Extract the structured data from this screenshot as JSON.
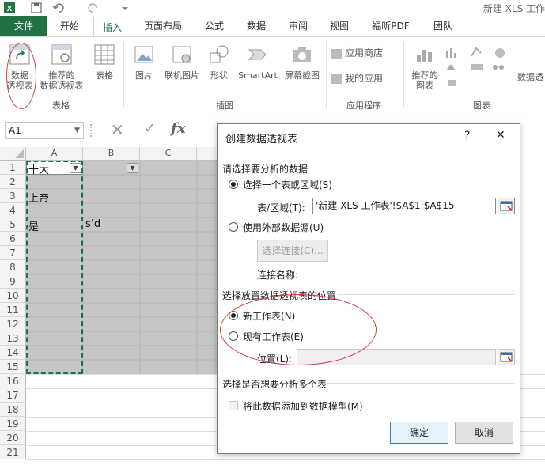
{
  "window": {
    "title": "新建 XLS 工作"
  },
  "tabs": {
    "file": "文件",
    "home": "开始",
    "insert": "插入",
    "layout": "页面布局",
    "formulas": "公式",
    "data": "数据",
    "review": "审阅",
    "view": "视图",
    "foxit": "福昕PDF",
    "team": "团队"
  },
  "ribbon": {
    "pivot": {
      "line1": "数据",
      "line2": "透视表"
    },
    "rec_pivot": {
      "line1": "推荐的",
      "line2": "数据透视表"
    },
    "table": "表格",
    "picture": "图片",
    "online_picture": "联机图片",
    "shapes": "形状",
    "smartart": "SmartArt",
    "screenshot": "屏幕截图",
    "app_store": "应用商店",
    "my_apps": "我的应用",
    "rec_chart": {
      "line1": "推荐的",
      "line2": "图表"
    },
    "pivot_chart_partial": "数据透",
    "groups": {
      "tables": "表格",
      "illustrations": "插图",
      "apps": "应用程序",
      "charts": "图表"
    }
  },
  "formula_bar": {
    "name_box": "A1",
    "fx": "fx"
  },
  "sheet": {
    "columns": [
      "A",
      "B",
      "C"
    ],
    "rows": [
      "1",
      "2",
      "3",
      "4",
      "5",
      "6",
      "7",
      "8",
      "9",
      "10",
      "11",
      "12",
      "13",
      "14",
      "15",
      "16",
      "17",
      "18",
      "19",
      "20",
      "21"
    ],
    "a1": "十大",
    "a3": "上帝",
    "a5": "是",
    "b5": "s’d"
  },
  "dialog": {
    "title": "创建数据透视表",
    "help": "?",
    "close": "✕",
    "section1": "请选择要分析的数据",
    "opt_range": "选择一个表或区域(S)",
    "range_label": "表/区域(T):",
    "range_value": "'新建 XLS 工作表'!$A$1:$A$15",
    "opt_external": "使用外部数据源(U)",
    "choose_conn": "选择连接(C)...",
    "conn_name": "连接名称:",
    "section2": "选择放置数据透视表的位置",
    "opt_new": "新工作表(N)",
    "opt_existing": "现有工作表(E)",
    "location_label": "位置(L):",
    "location_value": "",
    "section3": "选择是否想要分析多个表",
    "add_model": "将此数据添加到数据模型(M)",
    "ok": "确定",
    "cancel": "取消",
    "selected_source": "range",
    "selected_location": "new"
  },
  "colors": {
    "excel_green": "#217346",
    "annotation_red": "#d93a3a",
    "selection_gray": "#c6c6c6"
  }
}
